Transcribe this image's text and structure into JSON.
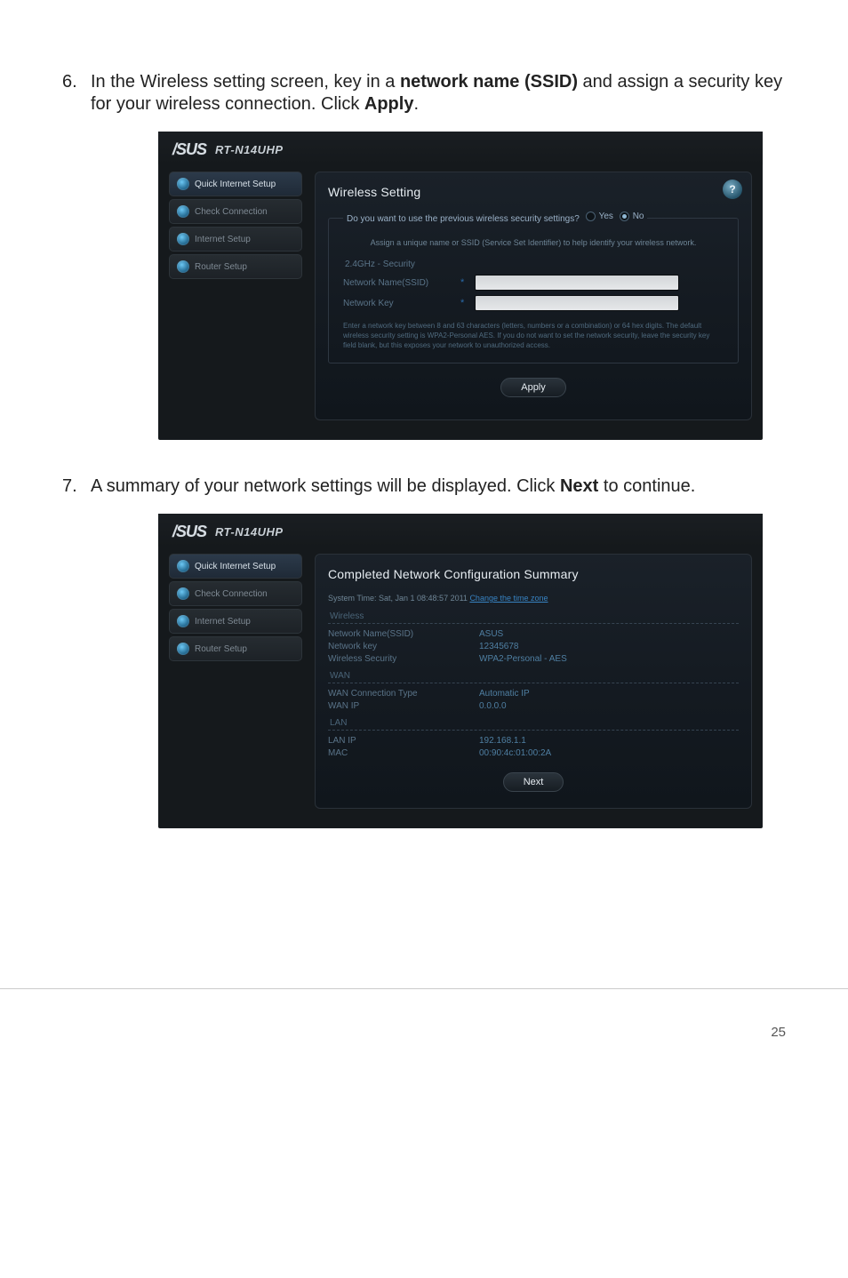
{
  "instructions": {
    "step6": {
      "num": "6.",
      "prefix": "In the Wireless setting screen, key in a ",
      "bold1": "network name (SSID)",
      "mid": " and assign a security key for your wireless connection. Click ",
      "bold2": "Apply",
      "suffix": "."
    },
    "step7": {
      "num": "7.",
      "prefix": "A summary of your network settings will be displayed. Click ",
      "bold1": "Next",
      "suffix": " to continue."
    }
  },
  "brand": "/SUS",
  "model": "RT-N14UHP",
  "sidebar": {
    "items": [
      "Quick Internet Setup",
      "Check Connection",
      "Internet Setup",
      "Router Setup"
    ]
  },
  "screen1": {
    "title": "Wireless Setting",
    "help": "?",
    "legend_q": "Do you want to use the previous wireless security settings?",
    "legend_yes": "Yes",
    "legend_no": "No",
    "hint": "Assign a unique name or SSID (Service Set Identifier) to help identify your wireless network.",
    "band": "2.4GHz - Security",
    "name_label": "Network Name(SSID)",
    "name_value": "",
    "key_label": "Network Key",
    "key_value": "",
    "fine_print": "Enter a network key between 8 and 63 characters (letters, numbers or a combination) or 64 hex digits. The default wireless security setting is WPA2-Personal AES. If you do not want to set the network security, leave the security key field blank, but this exposes your network to unauthorized access.",
    "apply_label": "Apply"
  },
  "screen2": {
    "title": "Completed Network Configuration Summary",
    "time_prefix": "System Time: Sat, Jan 1 08:48:57 2011 ",
    "time_link": "Change the time zone",
    "sections": {
      "wireless": {
        "label": "Wireless",
        "rows": [
          {
            "k": "Network Name(SSID)",
            "v": "ASUS"
          },
          {
            "k": "Network key",
            "v": "12345678"
          },
          {
            "k": "Wireless Security",
            "v": "WPA2-Personal - AES"
          }
        ]
      },
      "wan": {
        "label": "WAN",
        "rows": [
          {
            "k": "WAN Connection Type",
            "v": "Automatic IP"
          },
          {
            "k": "WAN IP",
            "v": "0.0.0.0"
          }
        ]
      },
      "lan": {
        "label": "LAN",
        "rows": [
          {
            "k": "LAN IP",
            "v": "192.168.1.1"
          },
          {
            "k": "MAC",
            "v": "00:90:4c:01:00:2A"
          }
        ]
      }
    },
    "next_label": "Next"
  },
  "page_number": "25"
}
